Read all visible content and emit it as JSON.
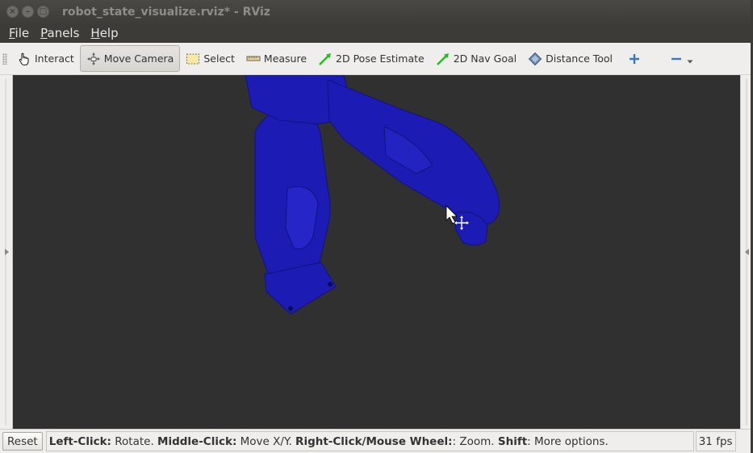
{
  "window": {
    "title": "robot_state_visualize.rviz* - RViz"
  },
  "menu": [
    {
      "mnemonic": "F",
      "rest": "ile"
    },
    {
      "mnemonic": "P",
      "rest": "anels"
    },
    {
      "mnemonic": "H",
      "rest": "elp"
    }
  ],
  "toolbar": {
    "interact": "Interact",
    "move_camera": "Move Camera",
    "select": "Select",
    "measure": "Measure",
    "pose_estimate": "2D Pose Estimate",
    "nav_goal": "2D Nav Goal",
    "distance_tool": "Distance Tool",
    "active_tool": "Move Camera"
  },
  "status": {
    "reset": "Reset",
    "left_click": "Left-Click:",
    "left_click_desc": " Rotate. ",
    "middle_click": "Middle-Click:",
    "middle_click_desc": " Move X/Y. ",
    "right_click": "Right-Click/Mouse Wheel:",
    "right_click_desc": ": Zoom. ",
    "shift": "Shift",
    "shift_desc": ": More options.",
    "fps": "31 fps"
  },
  "colors": {
    "robot": "#1c1cb4",
    "viewport_bg": "#303030",
    "accent_green": "#1fbf1f"
  }
}
